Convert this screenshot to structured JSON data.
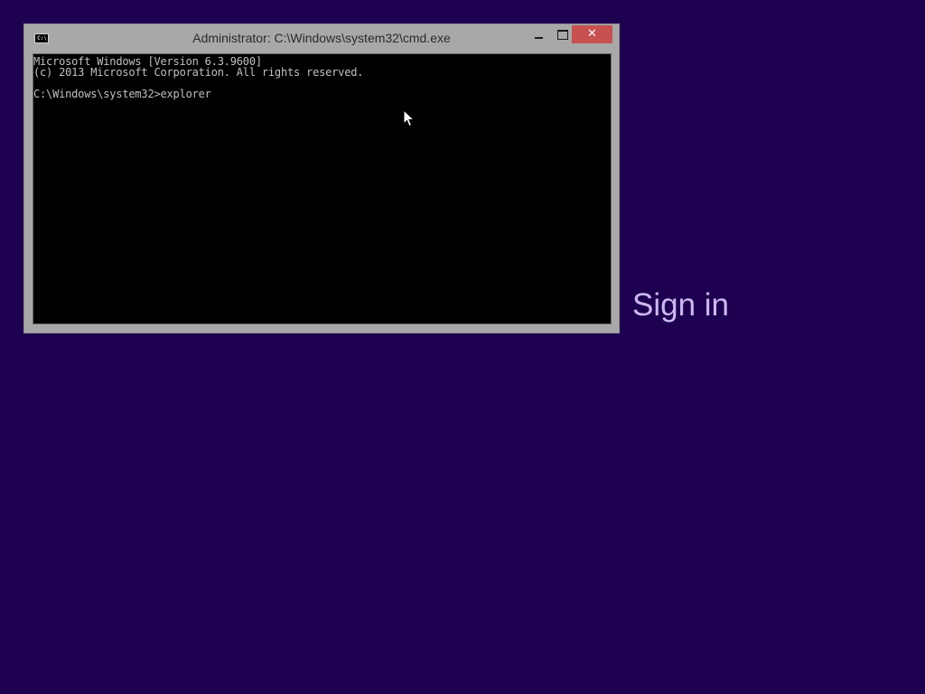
{
  "window": {
    "title": "Administrator: C:\\Windows\\system32\\cmd.exe",
    "icon_label": "C:\\.",
    "close_glyph": "✕"
  },
  "console": {
    "lines": [
      "Microsoft Windows [Version 6.3.9600]",
      "(c) 2013 Microsoft Corporation. All rights reserved.",
      "",
      "C:\\Windows\\system32>explorer"
    ]
  },
  "lockscreen": {
    "sign_in_label": "Sign in"
  },
  "colors": {
    "background": "#1e0050",
    "window_frame": "#a8a8a8",
    "close_button": "#c75050",
    "console_bg": "#000000",
    "console_text": "#c0c0c0",
    "sign_in_text": "#c9b9f0"
  }
}
